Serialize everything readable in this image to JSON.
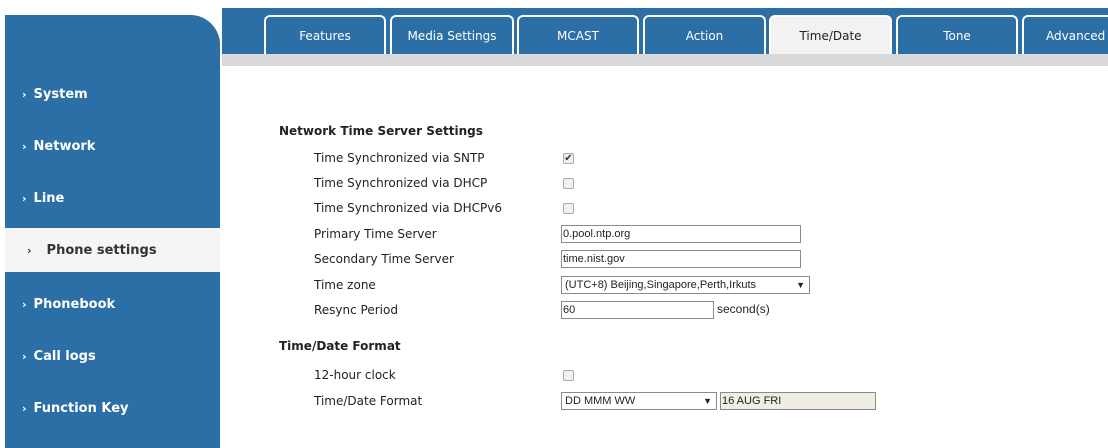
{
  "sidebar": {
    "items": [
      {
        "label": "System"
      },
      {
        "label": "Network"
      },
      {
        "label": "Line"
      },
      {
        "label": "Phone settings"
      },
      {
        "label": "Phonebook"
      },
      {
        "label": "Call logs"
      },
      {
        "label": "Function Key"
      }
    ],
    "active": "Phone settings"
  },
  "tabs": [
    {
      "label": "Features"
    },
    {
      "label": "Media Settings"
    },
    {
      "label": "MCAST"
    },
    {
      "label": "Action"
    },
    {
      "label": "Time/Date"
    },
    {
      "label": "Tone"
    },
    {
      "label": "Advanced"
    }
  ],
  "active_tab": "Time/Date",
  "network_time": {
    "title": "Network Time Server Settings",
    "sntp_label": "Time Synchronized via SNTP",
    "sntp_checked": true,
    "dhcp_label": "Time Synchronized via DHCP",
    "dhcp_checked": false,
    "dhcpv6_label": "Time Synchronized via DHCPv6",
    "dhcpv6_checked": false,
    "primary_label": "Primary Time Server",
    "primary_value": "0.pool.ntp.org",
    "secondary_label": "Secondary Time Server",
    "secondary_value": "time.nist.gov",
    "timezone_label": "Time zone",
    "timezone_value": "(UTC+8) Beijing,Singapore,Perth,Irkuts",
    "resync_label": "Resync Period",
    "resync_value": "60",
    "resync_unit": "second(s)"
  },
  "format": {
    "title": "Time/Date Format",
    "clock_label": "12-hour clock",
    "clock_checked": false,
    "format_label": "Time/Date Format",
    "format_value": "DD MMM WW",
    "format_preview": "16 AUG FRI"
  },
  "colors": {
    "brand": "#2c6fa6",
    "active_tab_bg": "#f2f2f2",
    "subbar": "#d9d9d9"
  }
}
